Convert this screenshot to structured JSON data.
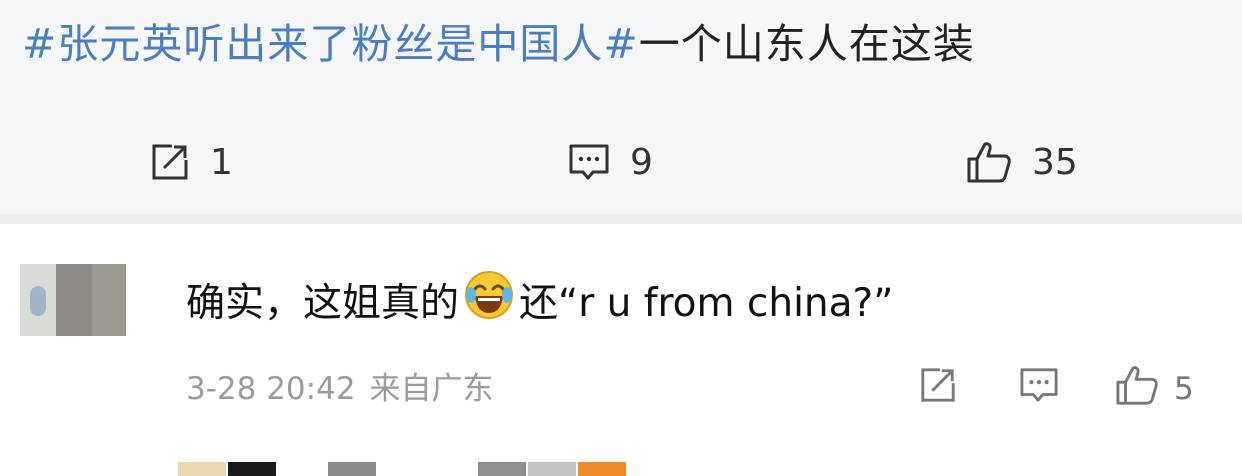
{
  "post": {
    "topic": "#张元英听出来了粉丝是中国人#",
    "text": "一个山东人在这装",
    "actions": {
      "repost": {
        "icon": "repost-icon",
        "count": "1"
      },
      "comment": {
        "icon": "comment-icon",
        "count": "9"
      },
      "like": {
        "icon": "thumbs-up-icon",
        "count": "35"
      }
    }
  },
  "comment": {
    "text_before": "确实，这姐真的",
    "emoji": "laughing-crying-emoji",
    "text_after": "还“r u from china?”",
    "date": "3-28 20:42",
    "location": "来自广东",
    "actions": {
      "repost": {
        "icon": "repost-icon"
      },
      "reply": {
        "icon": "comment-icon"
      },
      "like": {
        "icon": "thumbs-up-icon",
        "count": "5"
      }
    }
  },
  "colors": {
    "topic": "#4b7dbf",
    "background": "#f6f7f9",
    "meta": "#9b9b9b"
  }
}
